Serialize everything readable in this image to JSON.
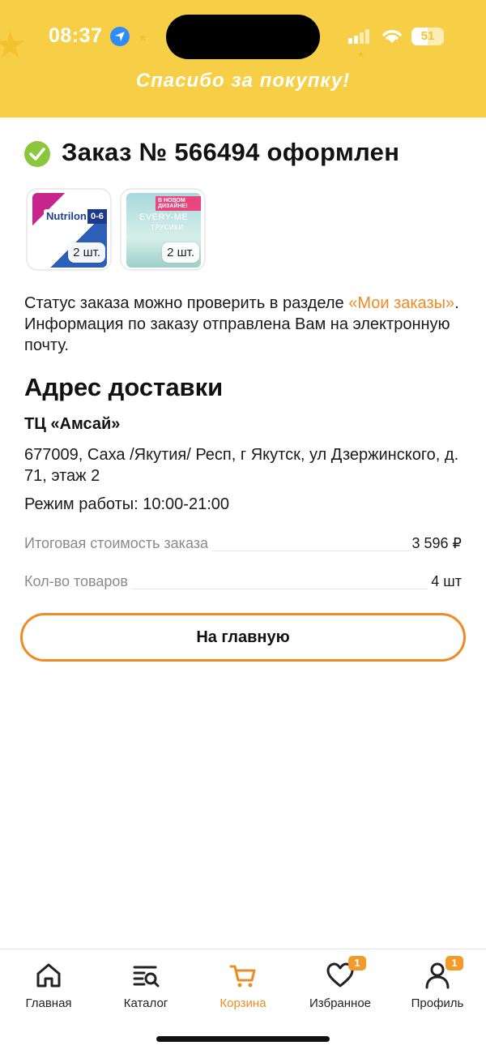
{
  "status_bar": {
    "time": "08:37",
    "battery": "51"
  },
  "header": {
    "title": "Спасибо за покупку!"
  },
  "order": {
    "title": "Заказ № 566494 оформлен"
  },
  "products": [
    {
      "brand": "Nutrilon",
      "age": "0-6",
      "quantity": "2 шт."
    },
    {
      "brand": "EVERY-ME",
      "subtitle": "ТРУСИКИ",
      "promo": "В НОВОМ ДИЗАЙНЕ!",
      "quantity": "2 шт."
    }
  ],
  "info": {
    "before_link": "Статус заказа можно проверить в разделе ",
    "link": "«Мои заказы»",
    "after_link": ". Информация по заказу отправлена Вам на электронную почту."
  },
  "delivery": {
    "section_title": "Адрес доставки",
    "store_name": "ТЦ «Амсай»",
    "address": "677009, Саха /Якутия/ Респ, г Якутск, ул Дзержинского, д. 71, этаж 2",
    "hours": "Режим работы: 10:00-21:00"
  },
  "summary": {
    "total_label": "Итоговая стоимость заказа",
    "total_value": "3 596 ₽",
    "count_label": "Кол-во товаров",
    "count_value": "4 шт"
  },
  "buttons": {
    "home": "На главную"
  },
  "nav": {
    "items": [
      {
        "label": "Главная",
        "icon": "home-icon"
      },
      {
        "label": "Каталог",
        "icon": "catalog-icon"
      },
      {
        "label": "Корзина",
        "icon": "cart-icon",
        "active": true
      },
      {
        "label": "Избранное",
        "icon": "heart-icon",
        "badge": "1"
      },
      {
        "label": "Профиль",
        "icon": "profile-icon",
        "badge": "1"
      }
    ]
  },
  "colors": {
    "header_bg": "#f7cf47",
    "accent": "#f08a24",
    "check": "#8cc63f",
    "badge": "#f39a2b"
  }
}
